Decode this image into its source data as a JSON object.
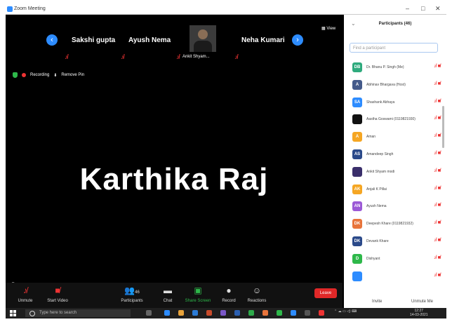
{
  "window": {
    "title": "Zoom Meeting",
    "controls": [
      "–",
      "□",
      "✕"
    ]
  },
  "gallery": {
    "participants": [
      "Sakshi gupta",
      "Ayush Nema",
      "Neha Kumari"
    ],
    "thumbnail_name": "Ankit Shyam...",
    "view_label": "View"
  },
  "recording": {
    "label": "Recording",
    "remove_pin": "Remove Pin"
  },
  "speaker": {
    "name": "Karthika Raj"
  },
  "toolbar": {
    "unmute": "Unmute",
    "start_video": "Start Video",
    "participants": "Participants",
    "participants_count": "46",
    "chat": "Chat",
    "share_screen": "Share Screen",
    "record": "Record",
    "reactions": "Reactions",
    "leave": "Leave"
  },
  "panel": {
    "title": "Participants (46)",
    "search_placeholder": "Find a participant",
    "list": [
      {
        "initials": "DB",
        "name": "Dr. Bhanu P. Singh (Me)",
        "color": "#2eaa7d"
      },
      {
        "initials": "A",
        "name": "Abhinav Bhargava (Host)",
        "color": "#445a8a"
      },
      {
        "initials": "SA",
        "name": "Shashank Abhaya",
        "color": "#2d8cff"
      },
      {
        "initials": "",
        "name": "Aastha Goswami (0119821930)",
        "color": "#111111"
      },
      {
        "initials": "A",
        "name": "Aman",
        "color": "#f5a623"
      },
      {
        "initials": "AS",
        "name": "Amandeep Singh",
        "color": "#2b4a8a"
      },
      {
        "initials": "",
        "name": "Ankit Shyam modi",
        "color": "#3a2f6b"
      },
      {
        "initials": "AK",
        "name": "Anjali K Pillai",
        "color": "#f5a623"
      },
      {
        "initials": "AN",
        "name": "Ayush Nema",
        "color": "#9b59d6"
      },
      {
        "initials": "DK",
        "name": "Deepesh Khare (0119821932)",
        "color": "#e8743b"
      },
      {
        "initials": "DK",
        "name": "Devank Khare",
        "color": "#2b4a8a"
      },
      {
        "initials": "D",
        "name": "Dishyant",
        "color": "#2eb84a"
      },
      {
        "initials": "",
        "name": "",
        "color": "#2d8cff"
      }
    ],
    "invite": "Invite",
    "unmute_me": "Unmute Me"
  },
  "taskbar": {
    "search_text": "Type here to search",
    "time": "12:27",
    "date": "14-03-2021"
  },
  "colors": {
    "accent": "#2d8cff",
    "leave": "#e02828",
    "share": "#2eb84a",
    "muted": "#e33"
  }
}
